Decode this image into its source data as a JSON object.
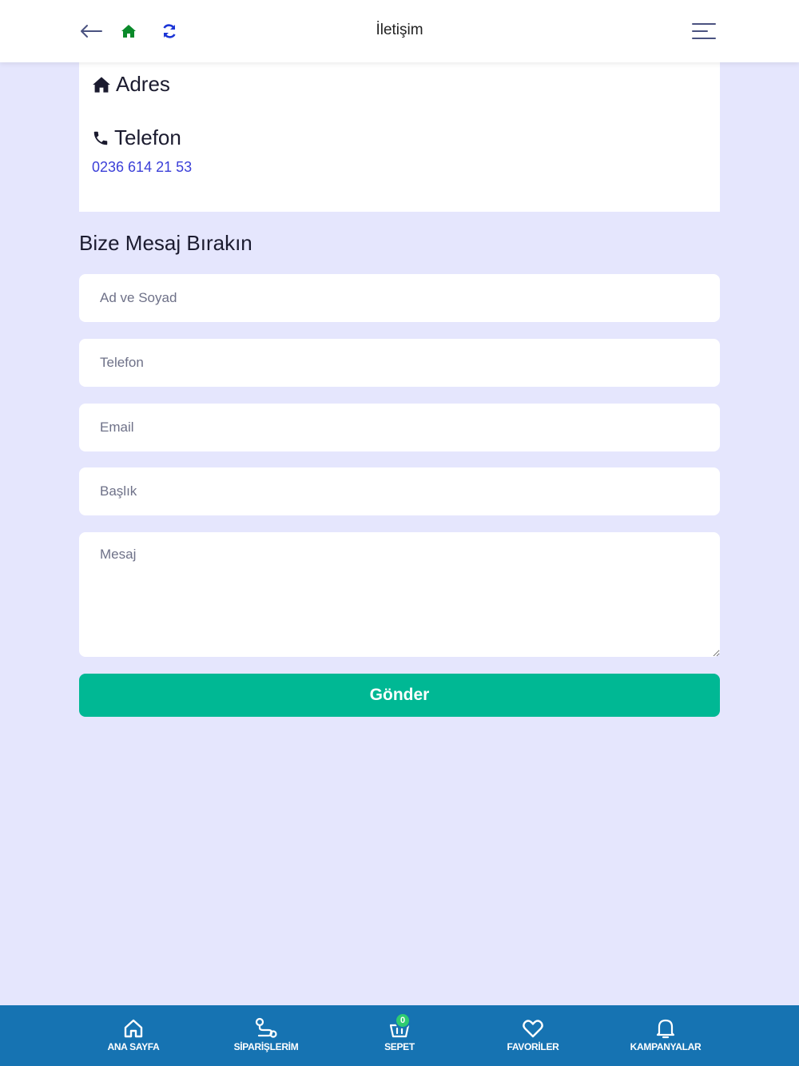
{
  "header": {
    "title": "İletişim",
    "icons": {
      "back": "arrow-left-icon",
      "home": "home-icon",
      "refresh": "refresh-icon",
      "menu": "menu-icon"
    },
    "colors": {
      "home": "#0a8a2a",
      "refresh": "#1b35d6",
      "back": "#4a5280"
    }
  },
  "contact": {
    "address_heading": "Adres",
    "phone_heading": "Telefon",
    "phone_number": "0236 614 21 53"
  },
  "form": {
    "title": "Bize Mesaj Bırakın",
    "name_placeholder": "Ad ve Soyad",
    "phone_placeholder": "Telefon",
    "email_placeholder": "Email",
    "subject_placeholder": "Başlık",
    "message_placeholder": "Mesaj",
    "submit_label": "Gönder"
  },
  "bottom_nav": {
    "items": [
      {
        "label": "ANA SAYFA",
        "icon": "home-outline-icon"
      },
      {
        "label": "SİPARİŞLERİM",
        "icon": "route-icon"
      },
      {
        "label": "SEPET",
        "icon": "basket-icon",
        "badge": "0"
      },
      {
        "label": "FAVORİLER",
        "icon": "heart-icon"
      },
      {
        "label": "KAMPANYALAR",
        "icon": "bell-icon"
      }
    ]
  },
  "colors": {
    "background": "#e5e6fd",
    "accent": "#00b894",
    "nav": "#1673b2",
    "link": "#3b3fd8"
  }
}
